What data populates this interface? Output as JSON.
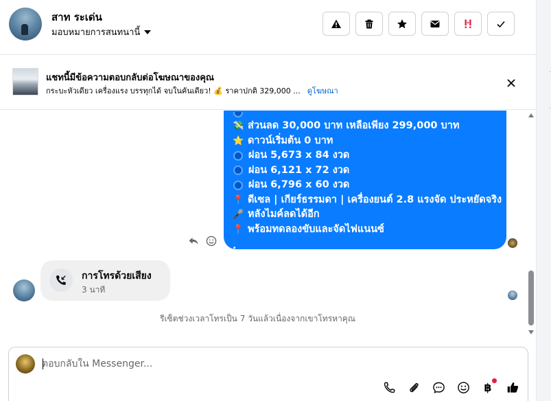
{
  "header": {
    "contact_name": "สาท ระเด่น",
    "assign_label": "มอบหมายการสนทนานี้",
    "actions": [
      "alert-icon",
      "trash-icon",
      "star-icon",
      "envelope-icon",
      "spam-icon",
      "check-icon"
    ]
  },
  "ad_banner": {
    "title": "แชทนี้มีข้อความตอบกลับต่อโฆษณาของคุณ",
    "subtitle": "กระบะหัวเดียว เครื่องแรง บรรทุกได้ จบในคันเดียว! 💰 ราคาปกติ 329,000 ...",
    "link_label": "ดูโฆษณา"
  },
  "message_bubble": {
    "lines": [
      {
        "icon": "💸",
        "text": "ส่วนลด 30,000 บาท เหลือเพียง 299,000 บาท"
      },
      {
        "icon": "⭐",
        "text": "ดาวน์เริ่มต้น 0 บาท"
      },
      {
        "icon": "circle",
        "text": "ผ่อน 5,673 x 84 งวด"
      },
      {
        "icon": "circle",
        "text": "ผ่อน 6,121 x 72 งวด"
      },
      {
        "icon": "circle",
        "text": "ผ่อน 6,796 x 60 งวด"
      },
      {
        "icon": "📍",
        "text": "ดีเซล | เกียร์ธรรมดา | เครื่องยนต์ 2.8 แรงจัด ประหยัดจริง"
      },
      {
        "icon": "🎤",
        "text": "หลังไมค์ลดได้อีก"
      },
      {
        "icon": "📍",
        "text": "พร้อมทดลองขับและจัดไฟแนนซ์"
      }
    ],
    "trailing": "."
  },
  "voice_call": {
    "title": "การโทรด้วยเสียง",
    "duration": "3 นาที"
  },
  "system_note": "รีเซ็ตช่วงเวลาโทรเป็น 7 วันแล้วเนื่องจากเขาโทรหาคุณ",
  "composer": {
    "placeholder": "ตอบกลับใน Messenger...",
    "baht_symbol": "฿",
    "tools": [
      "phone-icon",
      "paperclip-icon",
      "chat-bubble-icon",
      "emoji-icon",
      "baht-icon",
      "thumbs-up-icon"
    ]
  },
  "colors": {
    "bubble": "#0a7cff",
    "link": "#0064d1",
    "notification": "#e41e3f"
  }
}
